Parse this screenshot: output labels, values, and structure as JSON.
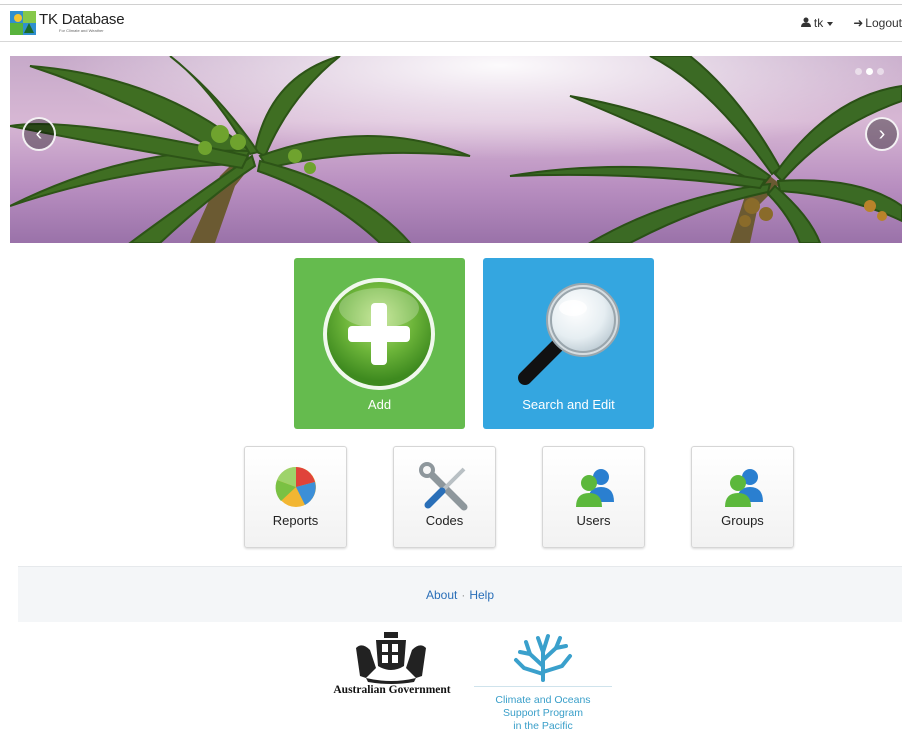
{
  "app": {
    "brand_title": "TK Database",
    "brand_subtitle": "For Climate and Weather"
  },
  "nav": {
    "user_label": "tk",
    "logout_label": "Logout"
  },
  "carousel": {
    "prev_icon": "chevron-left-icon",
    "next_icon": "chevron-right-icon",
    "slide_count": 3,
    "active_slide": 2
  },
  "tiles": {
    "add_label": "Add",
    "search_label": "Search and Edit",
    "add_color": "#65bb4e",
    "search_color": "#34a6e0"
  },
  "small_tiles": {
    "reports_label": "Reports",
    "codes_label": "Codes",
    "users_label": "Users",
    "groups_label": "Groups"
  },
  "footer": {
    "about_label": "About",
    "separator": "·",
    "help_label": "Help",
    "gov_label": "Australian Government",
    "program_line1": "Climate and Oceans",
    "program_line2": "Support Program",
    "program_line3": "in the Pacific",
    "link_color": "#2a6fb8"
  }
}
